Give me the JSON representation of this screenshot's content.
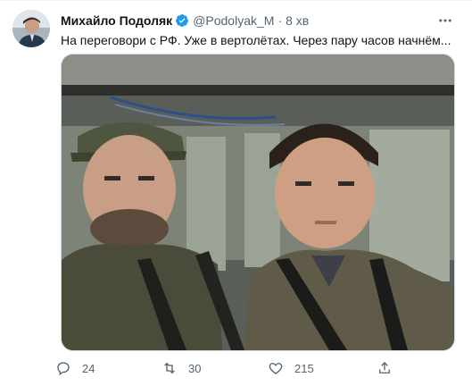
{
  "tweet": {
    "author_name": "Михайло Подоляк",
    "handle": "@Podolyak_M",
    "separator": "·",
    "time": "8 хв",
    "text": "На переговори с РФ. Уже в вертолётах. Через пару часов начнём...",
    "verified": true,
    "media_description_icon": "photo"
  },
  "actions": {
    "reply_count": "24",
    "retweet_count": "30",
    "like_count": "215"
  },
  "colors": {
    "verified_blue": "#1d9bf0",
    "secondary_text": "#536471",
    "primary_text": "#0f1419"
  }
}
